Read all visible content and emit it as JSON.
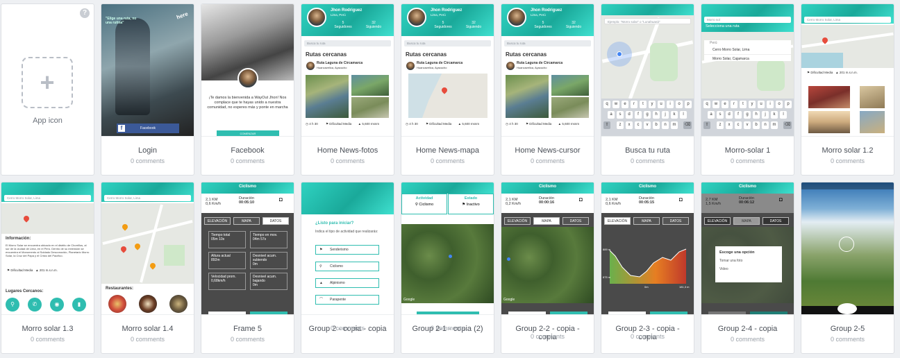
{
  "app_icon": {
    "label": "App icon",
    "help": "?"
  },
  "screens": [
    {
      "title": "Login",
      "comments": "0 comments",
      "text": {
        "tag": "\"Elige una ruta, no una rutina\"",
        "brand": "here",
        "btn": "Facebook"
      }
    },
    {
      "title": "Facebook",
      "comments": "0 comments",
      "text": {
        "msg": "¡Te damos la bienvenida a WayOut Jhon! Nos complace que te hayas unido a nuestra comunidad, no esperes más y ponte en marcha",
        "btn": "COMENZAR"
      }
    },
    {
      "title": "Home News-fotos",
      "comments": "0 comments",
      "text": {
        "name": "Jhon Rodriguez",
        "loc": "Lima, Perú",
        "s1": "Seguidores",
        "s2": "Siguiendo",
        "n1": "5",
        "n2": "32",
        "search": "Busca tu ruta",
        "section": "Rutas cercanas",
        "route": "Ruta Laguna de Circamarca",
        "place": "Huancavelica, Ayacucho",
        "d1": "4 h 30",
        "d2": "Dificultad Media",
        "d3": "5,600 msnm"
      }
    },
    {
      "title": "Home News-mapa",
      "comments": "0 comments",
      "text": {
        "name": "Jhon Rodriguez",
        "loc": "Lima, Perú",
        "s1": "Seguidores",
        "s2": "Siguiendo",
        "n1": "5",
        "n2": "32",
        "search": "Busca tu ruta",
        "section": "Rutas cercanas",
        "route": "Ruta Laguna de Circamarca",
        "place": "Huancavelica, Ayacucho",
        "d1": "4 h 30",
        "d2": "Dificultad Media",
        "d3": "5,600 msnm"
      }
    },
    {
      "title": "Home News-cursor",
      "comments": "0 comments",
      "text": {
        "name": "Jhon Rodriguez",
        "loc": "Lima, Perú",
        "s1": "Seguidores",
        "s2": "Siguiendo",
        "n1": "5",
        "n2": "32",
        "search": "Busca tu ruta",
        "section": "Rutas cercanas",
        "route": "Ruta Laguna de Circamarca",
        "place": "Huancavelica, Ayacucho",
        "d1": "4 h 30",
        "d2": "Dificultad Media",
        "d3": "5,600 msnm"
      }
    },
    {
      "title": "Busca tu ruta",
      "comments": "0 comments",
      "text": {
        "search": "Ejemplo: \"Morro solar\" o \"Lunahuaná\""
      }
    },
    {
      "title": "Morro-solar 1",
      "comments": "0 comments",
      "text": {
        "search": "Morro sol",
        "hint": "Selecciona una ruta",
        "o0": "Perú",
        "o1": "Cerro Morro Solar, Lima",
        "o2": "Morro Solar, Cajamarca"
      }
    },
    {
      "title": "Morro solar 1.2",
      "comments": "0 comments",
      "text": {
        "search": "Cerro Morro Solar, Lima",
        "d1": "Dificultad Media",
        "d2": "201 m.s.n.m."
      }
    },
    {
      "title": "Morro solar 1.3",
      "comments": "0 comments",
      "text": {
        "search": "Cerro Morro Solar, Lima",
        "info": "Información:",
        "body": "El Morro Solar se encuentra ubicado en el distrito de Chorrillos, al sur de la ciudad de Lima, en el Perú. Dentro de su extensión se encuentra el Monumento al Soldado Desconocido, Planetario Morro Solar, la Cruz del Papa y el Cristo del Pacífico.",
        "near": "Lugares Cercanos:",
        "d1": "Dificultad Media",
        "d2": "201 m.s.n.m."
      }
    },
    {
      "title": "Morro solar 1.4",
      "comments": "0 comments",
      "text": {
        "search": "Cerro Morro Solar, Lima",
        "rest": "Restaurantes:"
      }
    },
    {
      "title": "Frame 5",
      "comments": "0 comments",
      "text": {
        "head": "Ciclismo",
        "km": "2,1 KM",
        "speed": "0,6 Km/h",
        "durl": "Duración",
        "dur": "00:05:10",
        "t1": "ELEVACIÓN",
        "t2": "MAPA",
        "t3": "DATOS",
        "a1": "Tiempo total",
        "a1v": "05m 10s",
        "a2": "Tiempo en mov.",
        "a2v": "04m 57s",
        "a3": "Altura actual",
        "a3v": "892m",
        "a4": "Desnivel acum. subiendo",
        "a4v": "0m",
        "a5": "Velocidad prom.",
        "a5v": "0,68km/h",
        "a6": "Desnivel acum. bajando",
        "a6v": "0m"
      }
    },
    {
      "title": "Group 2 - copia - copia",
      "comments": "0 comments",
      "text": {
        "q": "¿Listo para iniciar?",
        "sub": "Indica el tipo de actividad que realizarás:",
        "o1": "Senderismo",
        "o2": "Ciclismo",
        "o3": "Alpinismo",
        "o4": "Parapente"
      }
    },
    {
      "title": "Group 2-1 - copia (2)",
      "comments": "0 comments",
      "text": {
        "t1": "Actividad",
        "t1v": "Ciclismo",
        "t2": "Estado",
        "t2v": "Inactivo",
        "g": "Google"
      }
    },
    {
      "title": "Group 2-2 - copia - copia",
      "comments": "0 comments",
      "text": {
        "head": "Ciclismo",
        "km": "2,1 KM",
        "speed": "0,2 Km/h",
        "durl": "Duración",
        "dur": "00:00:16",
        "t1": "ELEVACIÓN",
        "t2": "MAPA",
        "t3": "DATOS",
        "g": "Google"
      }
    },
    {
      "title": "Group 2-3 - copia - copia",
      "comments": "0 comments",
      "text": {
        "head": "Ciclismo",
        "km": "2,1 KM",
        "speed": "0,6 Km/h",
        "durl": "Duración",
        "dur": "00:05:15",
        "t1": "ELEVACIÓN",
        "t2": "MAPA",
        "t3": "DATOS",
        "y1": "889 m",
        "y2": "875 m",
        "x1": "0m",
        "x2": "181,3 m"
      }
    },
    {
      "title": "Group 2-4 - copia",
      "comments": "0 comments",
      "text": {
        "head": "Ciclismo",
        "km": "2,7 KM",
        "speed": "1,5 Km/h",
        "durl": "Duración",
        "dur": "00:06:12",
        "t1": "ELEVACIÓN",
        "t2": "MAPA",
        "t3": "DATOS",
        "dlg": "Escoge una opción",
        "o1": "Tomar una foto",
        "o2": "Video"
      }
    },
    {
      "title": "Group 2-5",
      "comments": "0 comments",
      "text": {}
    }
  ]
}
